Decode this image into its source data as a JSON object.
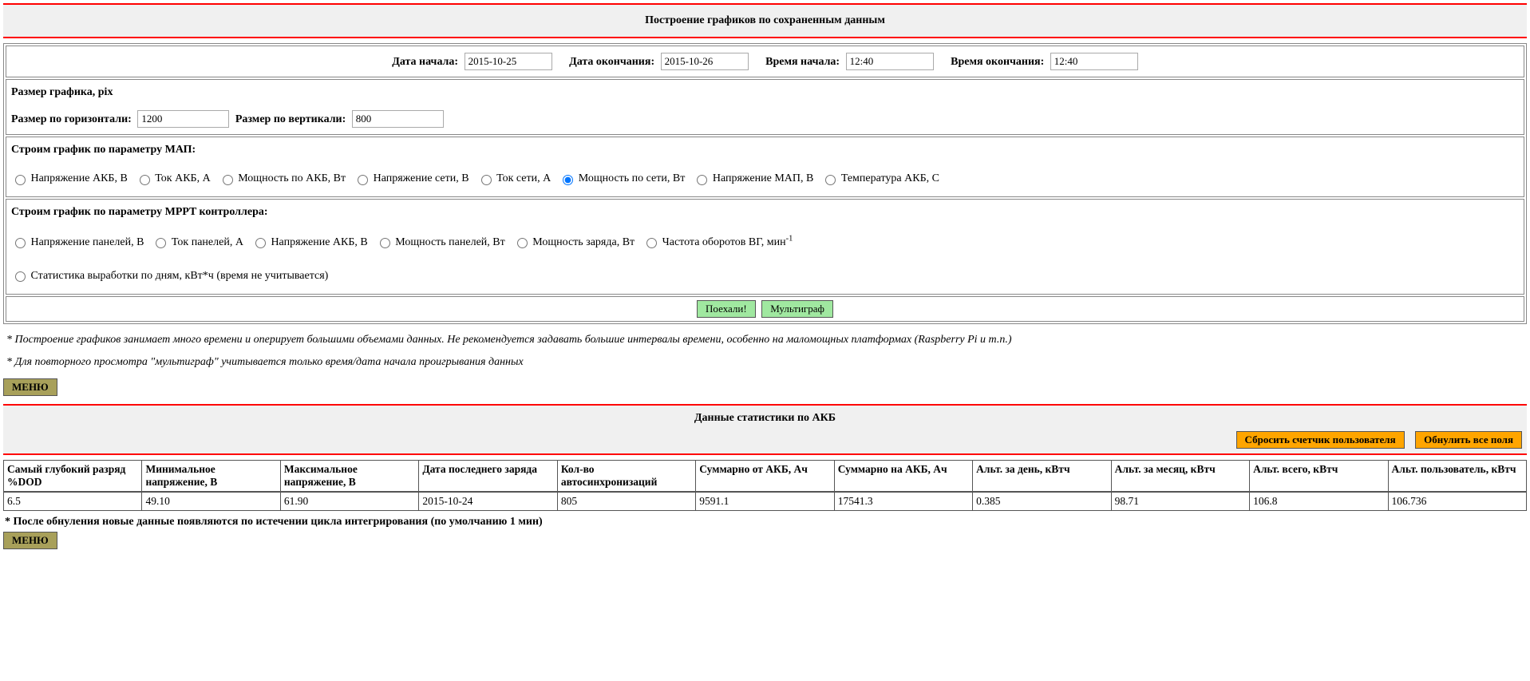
{
  "section1": {
    "title": "Построение графиков по сохраненным данным",
    "date_start_label": "Дата начала:",
    "date_start": "2015-10-25",
    "date_end_label": "Дата окончания:",
    "date_end": "2015-10-26",
    "time_start_label": "Время начала:",
    "time_start": "12:40",
    "time_end_label": "Время окончания:",
    "time_end": "12:40",
    "size_heading": "Размер графика, pix",
    "size_h_label": "Размер по горизонтали:",
    "size_h": "1200",
    "size_v_label": "Размер по вертикали:",
    "size_v": "800",
    "map_heading": "Строим график по параметру МАП:",
    "map_options": [
      "Напряжение АКБ, В",
      "Ток АКБ, А",
      "Мощность по АКБ, Вт",
      "Напряжение сети, В",
      "Ток сети, А",
      "Мощность по сети, Вт",
      "Напряжение МАП, В",
      "Температура АКБ, С"
    ],
    "map_selected_index": 5,
    "mppt_heading": "Строим график по параметру MPPT контроллера:",
    "mppt_options": [
      "Напряжение панелей, В",
      "Ток панелей, А",
      "Напряжение АКБ, В",
      "Мощность панелей, Вт",
      "Мощность заряда, Вт",
      "Частота оборотов ВГ, мин",
      "Статистика выработки по дням, кВт*ч (время не учитывается)"
    ],
    "go_btn": "Поехали!",
    "multi_btn": "Мультиграф",
    "note1": "* Построение графиков занимает много времени и оперирует большими объемами данных. Не рекомендуется задавать большие интервалы времени, особенно на маломощных платформах (Raspberry Pi и т.п.)",
    "note2": "* Для повторного просмотра \"мультиграф\" учитывается только время/дата начала проигрывания данных",
    "menu_btn": "МЕНЮ"
  },
  "section2": {
    "title": "Данные статистики по АКБ",
    "reset_counter_btn": "Сбросить счетчик пользователя",
    "reset_all_btn": "Обнулить все поля",
    "columns": [
      "Самый глубокий разряд %DOD",
      "Минимальное напряжение, В",
      "Максимальное напряжение, В",
      "Дата последнего заряда",
      "Кол-во автосинхронизаций",
      "Суммарно от АКБ, Ач",
      "Суммарно на АКБ, Ач",
      "Альт. за день, кВтч",
      "Альт. за месяц, кВтч",
      "Альт. всего, кВтч",
      "Альт. пользователь, кВтч"
    ],
    "row": [
      "6.5",
      "49.10",
      "61.90",
      "2015-10-24",
      "805",
      "9591.1",
      "17541.3",
      "0.385",
      "98.71",
      "106.8",
      "106.736"
    ],
    "footnote": "* После обнуления новые данные появляются по истечении цикла интегрирования (по умолчанию 1 мин)",
    "menu_btn": "МЕНЮ"
  }
}
